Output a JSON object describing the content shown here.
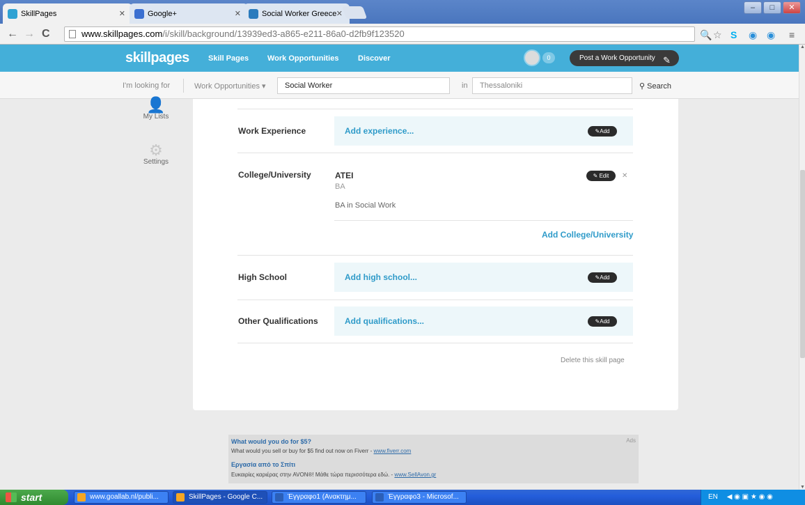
{
  "browser": {
    "tabs": [
      {
        "title": "SkillPages",
        "active": true
      },
      {
        "title": "Google+",
        "active": false
      },
      {
        "title": "Social Worker Greece",
        "active": false
      }
    ],
    "url_host": "www.skillpages.com",
    "url_path": "/i/skill/background/13939ed3-a865-e211-86a0-d2fb9f123520"
  },
  "site": {
    "logo": "skillpages",
    "nav": [
      "Skill Pages",
      "Work Opportunities",
      "Discover"
    ],
    "notif_count": "0",
    "post_button": "Post a Work Opportunity"
  },
  "search": {
    "looking_for_label": "I'm looking for",
    "category": "Work Opportunities",
    "query": "Social Worker",
    "in_label": "in",
    "location": "Thessaloniki",
    "search_label": "Search"
  },
  "sidebar": {
    "items": [
      {
        "label": "My Lists",
        "icon": "list-icon"
      },
      {
        "label": "Settings",
        "icon": "gear-icon"
      }
    ]
  },
  "sections": {
    "work_experience": {
      "label": "Work Experience",
      "add_link": "Add experience...",
      "button": "Add"
    },
    "college": {
      "label": "College/University",
      "school": "ATEI",
      "degree": "BA",
      "description": "BA in Social Work",
      "edit_button": "Edit",
      "add_link": "Add College/University"
    },
    "high_school": {
      "label": "High School",
      "add_link": "Add high school...",
      "button": "Add"
    },
    "other": {
      "label": "Other Qualifications",
      "add_link": "Add qualifications...",
      "button": "Add"
    },
    "delete_link": "Delete this skill page"
  },
  "ads": {
    "label": "Ads",
    "items": [
      {
        "title": "What would you do for $5?",
        "text": "What would you sell or buy for $5 find out now on Fiverr - ",
        "link": "www.fiverr.com"
      },
      {
        "title": "Εργασία από το Σπίτι",
        "text": "Ευκαιρίες καριέρας στην AVON®! Μάθε τώρα περισσότερα εδώ. - ",
        "link": "www.SellAvon.gr"
      }
    ]
  },
  "taskbar": {
    "start": "start",
    "tasks": [
      "www.goallab.nl/publi...",
      "SkillPages - Google C...",
      "Έγγραφο1 (Ανακτημ...",
      "Έγγραφο3 - Microsof..."
    ],
    "lang": "EN"
  },
  "colors": {
    "header": "#44afd9",
    "link": "#2f9bc9",
    "addbox": "#edf7fa"
  }
}
